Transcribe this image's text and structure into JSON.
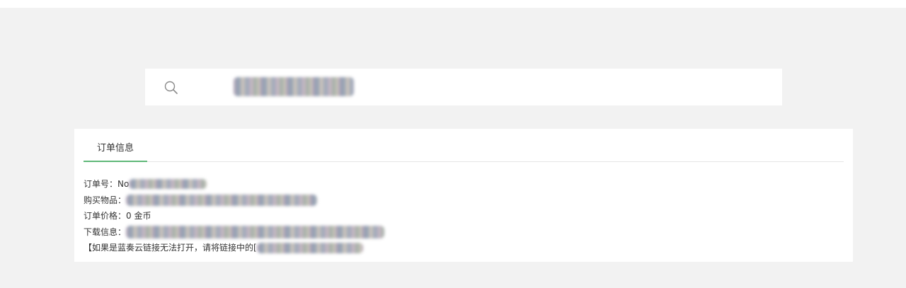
{
  "search": {
    "placeholder": ""
  },
  "tabs": [
    {
      "label": "订单信息",
      "active": true
    }
  ],
  "order": {
    "number_label": "订单号：",
    "number_prefix": "No",
    "item_label": "购买物品：",
    "price_label": "订单价格：",
    "price_value": "0 金币",
    "download_label": "下载信息：",
    "note": "【如果是蓝奏云链接无法打开，请将链接中的["
  },
  "colors": {
    "page_bg": "#f2f2f2",
    "card_bg": "#ffffff",
    "tab_accent": "#5fb878",
    "text": "#333333"
  }
}
